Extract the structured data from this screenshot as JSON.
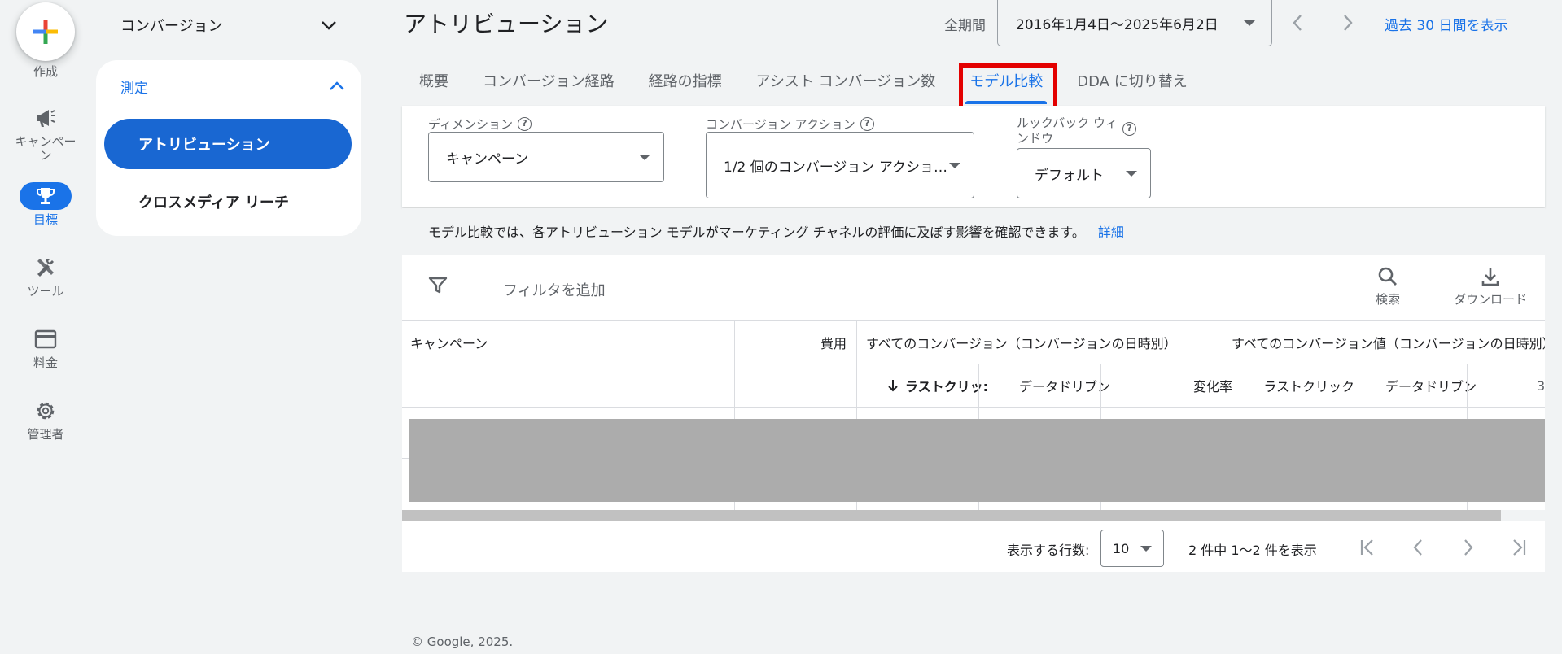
{
  "rail": {
    "create_label": "作成",
    "items": [
      {
        "label": "キャンペーン",
        "icon": "megaphone-icon"
      },
      {
        "label": "目標",
        "icon": "trophy-icon"
      },
      {
        "label": "ツール",
        "icon": "tools-icon"
      },
      {
        "label": "料金",
        "icon": "credit-card-icon"
      },
      {
        "label": "管理者",
        "icon": "gear-icon"
      }
    ]
  },
  "nav2": {
    "header": "コンバージョン",
    "section": "測定",
    "active_item": "アトリビューション",
    "item": "クロスメディア リーチ"
  },
  "header": {
    "title": "アトリビューション",
    "range_label": "全期間",
    "range_value": "2016年1月4日～2025年6月2日",
    "last30": "過去 30 日間を表示"
  },
  "tabs": [
    "概要",
    "コンバージョン経路",
    "経路の指標",
    "アシスト コンバージョン数",
    "モデル比較",
    "DDA に切り替え"
  ],
  "active_tab": "モデル比較",
  "filters": {
    "dimension_label": "ディメンション",
    "dimension_value": "キャンペーン",
    "conversion_label": "コンバージョン アクション",
    "conversion_value": "1/2 個のコンバージョン アクショ…",
    "lookback_label_line1": "ルックバック ウィ",
    "lookback_label_line2": "ンドウ",
    "lookback_value": "デフォルト"
  },
  "info": {
    "text": "モデル比較では、各アトリビューション モデルがマーケティング チャネルの評価に及ぼす影響を確認できます。",
    "link": "詳細"
  },
  "toolbar": {
    "add_filter": "フィルタを追加",
    "search": "検索",
    "download": "ダウンロード"
  },
  "table": {
    "col_campaign": "キャンペーン",
    "col_cost": "費用",
    "group_conversions": "すべてのコンバージョン（コンバージョンの日時別）",
    "group_values": "すべてのコンバージョン値（コンバージョンの日時別）",
    "sub_last_click": "ラストクリッ:",
    "sub_data_driven": "データドリブン",
    "sub_change": "変化率",
    "sub_last_click2": "ラストクリック",
    "sub_data_driven2": "データドリブン",
    "sub_overflow": "3"
  },
  "pager": {
    "rows_label": "表示する行数:",
    "rows_value": "10",
    "info": "2 件中 1～2 件を表示"
  },
  "footer": "© Google, 2025.",
  "colors": {
    "accent": "#1a73e8",
    "highlight": "#e30000",
    "mask": "#acacac"
  }
}
